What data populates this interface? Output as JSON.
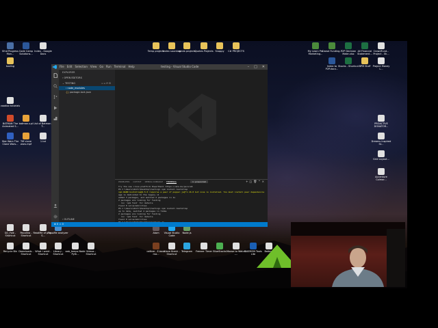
{
  "desktop": {
    "icons": [
      {
        "label": "Sfnd Progress Mon...",
        "color": "#4a6fa5"
      },
      {
        "label": "Code Camp Solutions...",
        "color": "#2b579a"
      },
      {
        "label": "Index - Google Docs",
        "color": "#e0e0e0"
      },
      {
        "label": "Temp projects",
        "color": "#e8c35a"
      },
      {
        "label": "Index sourcing",
        "color": "#e8c35a"
      },
      {
        "label": "zonda projects",
        "color": "#e8c35a"
      },
      {
        "label": "Quotes Projects",
        "color": "#e8c35a"
      },
      {
        "label": "Snappy",
        "color": "#e8c35a"
      },
      {
        "label": "C# PROJECTS",
        "color": "#e8c35a"
      },
      {
        "label": "My Learn Pro Marketing...",
        "color": "#4b8b3b"
      },
      {
        "label": "Crowd Funding...",
        "color": "#4b8b3b"
      },
      {
        "label": "P2P Decision Make.xlsx",
        "color": "#1d6f42"
      },
      {
        "label": "All Financial Statement...",
        "color": "#1d6f42"
      },
      {
        "label": "CrowdFund... Project - Sh...",
        "color": "#e0e0e0"
      },
      {
        "label": "tooling",
        "color": "#e8c35a"
      },
      {
        "label": "Index to P2P.docx...",
        "color": "#2b579a"
      },
      {
        "label": "Stocks - Shortcut",
        "color": "#1d6f42"
      },
      {
        "label": "BPM Stuff",
        "color": "#e8c35a"
      },
      {
        "label": "Project Money L...",
        "color": "#e0e0e0"
      },
      {
        "label": "voodoo tutorials",
        "color": "#e0e0e0"
      },
      {
        "label": "BATMAN The Animated S...",
        "color": "#d04a2a"
      },
      {
        "label": "batman.s.pl",
        "color": "#e8a33a"
      },
      {
        "label": "List of Batman - T...",
        "color": "#e0e0e0"
      },
      {
        "label": "PROACTIVE DONATOR...",
        "color": "#e0e0e0"
      },
      {
        "label": "Star Wars The Clone Wars...",
        "color": "#3060c0"
      },
      {
        "label": "Tiff clone wars.mpf",
        "color": "#e8a33a"
      },
      {
        "label": "1.txt",
        "color": "#e0e0e0"
      },
      {
        "label": "Dreams Inspired St...",
        "color": "#e0e0e0"
      },
      {
        "label": "Grid Layout...",
        "color": "#e0e0e0"
      },
      {
        "label": "Accenture Colmar...",
        "color": "#e0e0e0"
      },
      {
        "label": "GO_Folk - Shortcut",
        "color": "#e0e0e0"
      },
      {
        "label": "PacoSha - Shortcut",
        "color": "#e0e0e0"
      },
      {
        "label": "ReadMe of plsy - S...",
        "color": "#e0e0e0"
      },
      {
        "label": "PacoMe analyzer",
        "color": "#4a90d0"
      },
      {
        "label": "Atom",
        "color": "#66595c"
      },
      {
        "label": "Visual Studio Code",
        "color": "#23a9f2"
      },
      {
        "label": "Node.js",
        "color": "#68a063"
      },
      {
        "label": "Recycle Bin",
        "color": "#e0e0e0"
      },
      {
        "label": "Downloads - Shortcut",
        "color": "#e0e0e0"
      },
      {
        "label": "What I want - Shortcut",
        "color": "#e0e0e0"
      },
      {
        "label": "Library - Shortcut",
        "color": "#e0e0e0"
      },
      {
        "label": "aab_lamps Node Pyth...",
        "color": "#e0e0e0"
      },
      {
        "label": "Videos - Shortcut",
        "color": "#e0e0e0"
      },
      {
        "label": "calibre - E-book ma...",
        "color": "#7a3f1f"
      },
      {
        "label": "I love Bresh - Shortcut",
        "color": "#e0e0e0"
      },
      {
        "label": "Telegram",
        "color": "#2ca5e0"
      },
      {
        "label": "Freezer Timer",
        "color": "#e0e0e0"
      },
      {
        "label": "BlueStacks",
        "color": "#4caf50"
      },
      {
        "label": "Moose to Watch -...",
        "color": "#e0e0e0"
      },
      {
        "label": "DAEMON Tools Lite",
        "color": "#1a5fb4"
      },
      {
        "label": "Balbino",
        "color": "#e0e0e0"
      }
    ]
  },
  "vscode": {
    "menu": [
      "File",
      "Edit",
      "Selection",
      "View",
      "Go",
      "Run",
      "Terminal",
      "Help"
    ],
    "title": "testing - Visual Studio Code",
    "explorer_title": "EXPLORER",
    "open_editors": "OPEN EDITORS",
    "folder": "TESTING",
    "tree": [
      "node_modules",
      "package-lock.json"
    ],
    "outline": "OUTLINE",
    "panel_tabs": [
      "PROBLEMS",
      "OUTPUT",
      "DEBUG CONSOLE",
      "TERMINAL"
    ],
    "active_panel_tab": "TERMINAL",
    "terminal_select": "1: powershell",
    "terminal_lines": [
      "Try the new cross-platform PowerShell https://aka.ms/pscore6",
      "",
      "PS C:\\Users\\dmitr\\Desktop\\testing> npm install bootstrap",
      "npm WARN bootstrap@4.5.0 requires a peer of popper.js@^1.16.0 but none is installed. You must install peer dependencies yourself.",
      "age is dedicated to the legacy v1",
      "",
      "added 3 packages, and audited 4 packages in 1s",
      "",
      "2 packages are looking for funding",
      "  run `npm fund` for details",
      "",
      "found 0 vulnerabilities",
      "PS C:\\Users\\dmitr\\Desktop\\testing> npm install bootstrap",
      "",
      "up to date, audited 4 packages in 712ms",
      "",
      "2 packages are looking for funding",
      "  run `npm fund` for details",
      "",
      "found 0 vulnerabilities",
      "PS C:\\Users\\dmitr\\Desktop\\testing> []"
    ],
    "status_text": "⊗ 0 ⚠ 0"
  },
  "colors": {
    "vscode_bg": "#1e1e1e",
    "sidebar_bg": "#252526",
    "activitybar_bg": "#333333",
    "statusbar": "#007acc",
    "selection": "#094771"
  }
}
